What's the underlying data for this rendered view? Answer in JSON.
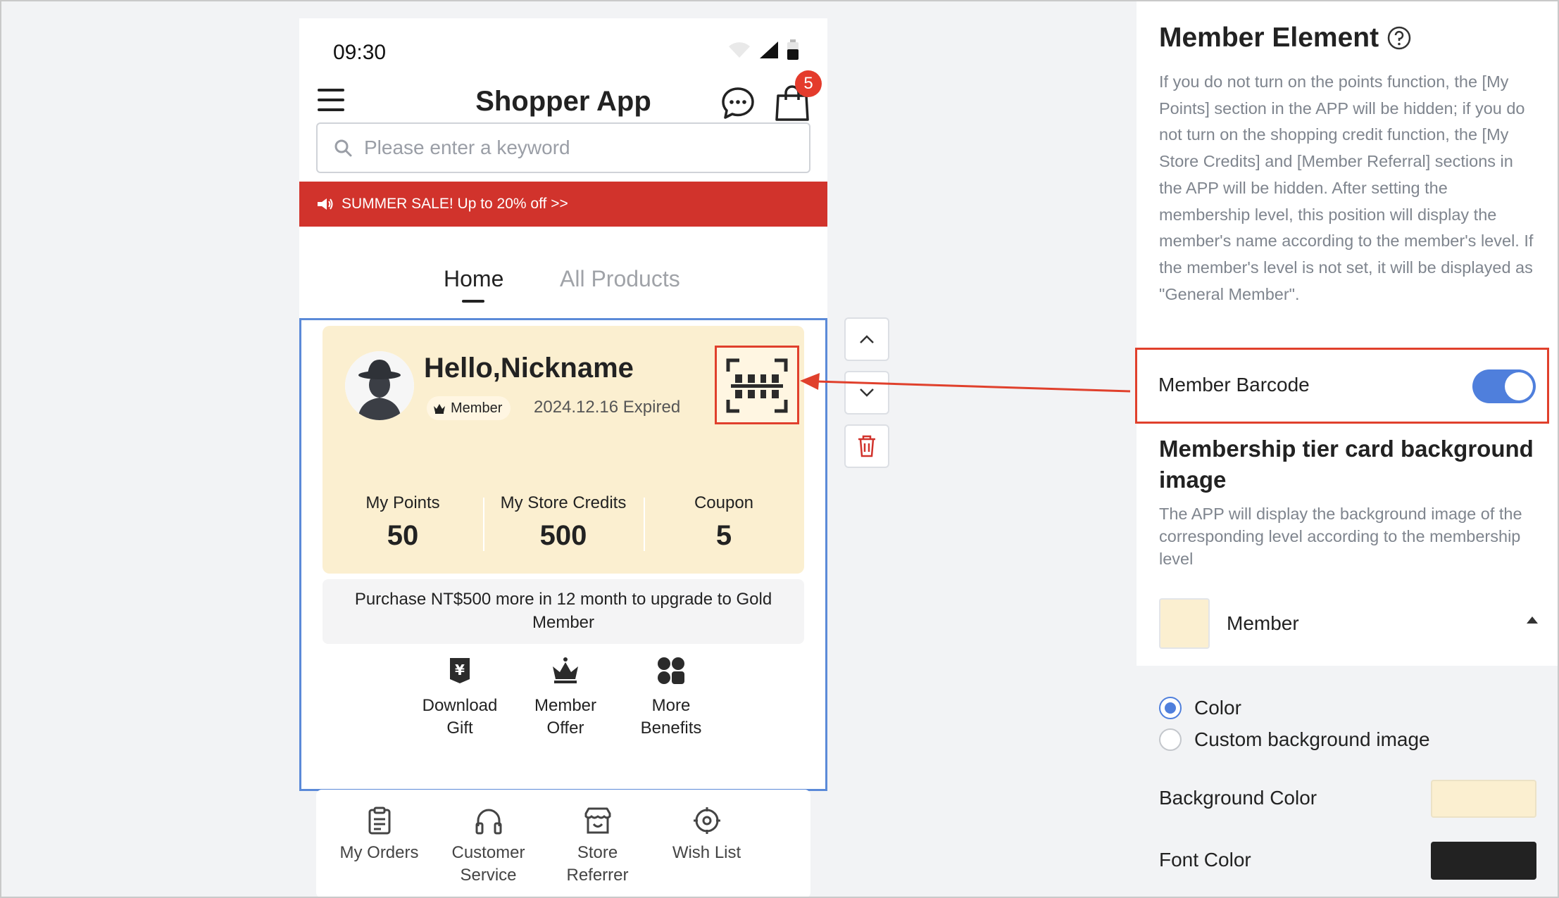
{
  "status_bar": {
    "time": "09:30"
  },
  "app": {
    "title": "Shopper App",
    "cart_count": "5",
    "search_placeholder": "Please enter a keyword",
    "promo": "SUMMER SALE! Up to 20% off >>",
    "tabs": [
      {
        "label": "Home",
        "active": true
      },
      {
        "label": "All Products",
        "active": false
      }
    ]
  },
  "member_card": {
    "greeting": "Hello,Nickname",
    "level_badge": "Member",
    "expiry": "2024.12.16 Expired",
    "stats": [
      {
        "label": "My Points",
        "value": "50"
      },
      {
        "label": "My Store Credits",
        "value": "500"
      },
      {
        "label": "Coupon",
        "value": "5"
      }
    ],
    "upgrade_note": "Purchase NT$500 more in 12 month to upgrade to Gold Member",
    "benefits": [
      {
        "line1": "Download",
        "line2": "Gift",
        "icon": "gift-voucher-icon"
      },
      {
        "line1": "Member",
        "line2": "Offer",
        "icon": "crown-icon"
      },
      {
        "line1": "More",
        "line2": "Benefits",
        "icon": "grid-benefits-icon"
      }
    ],
    "card_color": "#fbefd0"
  },
  "shortcuts": [
    {
      "line1": "My Orders",
      "line2": "",
      "icon": "clipboard-icon"
    },
    {
      "line1": "Customer",
      "line2": "Service",
      "icon": "headset-icon"
    },
    {
      "line1": "Store",
      "line2": "Referrer",
      "icon": "store-icon"
    },
    {
      "line1": "Wish List",
      "line2": "",
      "icon": "target-icon"
    }
  ],
  "panel": {
    "title": "Member Element",
    "description": "If you do not turn on the points function, the [My Points] section in the APP will be hidden; if you do not turn on the shopping credit function, the [My Store Credits] and [Member Referral] sections in the APP will be hidden. After setting the membership level, this position will display the member's name according to the member's level. If the member's level is not set, it will be displayed as \"General Member\".",
    "barcode_label": "Member Barcode",
    "barcode_enabled": true,
    "bg_section_title": "Membership tier card background image",
    "bg_section_desc": "The APP will display the background image of the corresponding level according to the membership level",
    "level_name": "Member",
    "radio_options": [
      {
        "label": "Color",
        "checked": true
      },
      {
        "label": "Custom background image",
        "checked": false
      }
    ],
    "background_color_label": "Background Color",
    "background_color": "#fbefd0",
    "font_color_label": "Font Color",
    "font_color": "#222222",
    "accent_color": "#4f7fdc",
    "highlight_color": "#e0402c"
  }
}
